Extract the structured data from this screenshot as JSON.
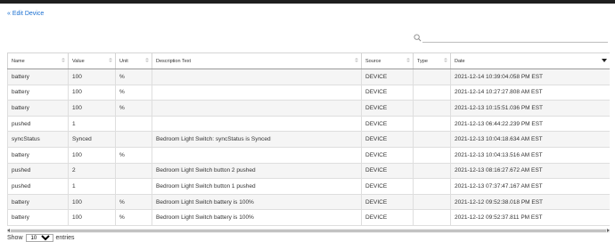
{
  "nav": {
    "back_link": "« Edit Device"
  },
  "search": {
    "placeholder": ""
  },
  "table": {
    "columns": [
      "Name",
      "Value",
      "Unit",
      "Description Text",
      "Source",
      "Type",
      "Date"
    ],
    "rows": [
      [
        "battery",
        "100",
        "%",
        "",
        "DEVICE",
        "",
        "2021-12-14 10:39:04.058 PM EST"
      ],
      [
        "battery",
        "100",
        "%",
        "",
        "DEVICE",
        "",
        "2021-12-14 10:27:27.808 AM EST"
      ],
      [
        "battery",
        "100",
        "%",
        "",
        "DEVICE",
        "",
        "2021-12-13 10:15:51.036 PM EST"
      ],
      [
        "pushed",
        "1",
        "",
        "",
        "DEVICE",
        "",
        "2021-12-13 06:44:22.239 PM EST"
      ],
      [
        "syncStatus",
        "Synced",
        "",
        "Bedroom Light Switch: syncStatus is Synced",
        "DEVICE",
        "",
        "2021-12-13 10:04:18.634 AM EST"
      ],
      [
        "battery",
        "100",
        "%",
        "",
        "DEVICE",
        "",
        "2021-12-13 10:04:13.516 AM EST"
      ],
      [
        "pushed",
        "2",
        "",
        "Bedroom Light Switch button 2 pushed",
        "DEVICE",
        "",
        "2021-12-13 08:16:27.672 AM EST"
      ],
      [
        "pushed",
        "1",
        "",
        "Bedroom Light Switch button 1 pushed",
        "DEVICE",
        "",
        "2021-12-13 07:37:47.167 AM EST"
      ],
      [
        "battery",
        "100",
        "%",
        "Bedroom Light Switch battery is 100%",
        "DEVICE",
        "",
        "2021-12-12 09:52:38.018 PM EST"
      ],
      [
        "battery",
        "100",
        "%",
        "Bedroom Light Switch battery is 100%",
        "DEVICE",
        "",
        "2021-12-12 09:52:37.811 PM EST"
      ]
    ]
  },
  "footer": {
    "show_label": "Show",
    "page_length": "10",
    "entries_label": "entries"
  },
  "colors": {
    "link": "#1a6fd1",
    "topbar": "#1f1f1f",
    "stripe": "#f5f5f5"
  },
  "icons": {
    "search": "search-icon",
    "sort": "sort-icon",
    "sort_desc": "sort-desc-icon"
  }
}
